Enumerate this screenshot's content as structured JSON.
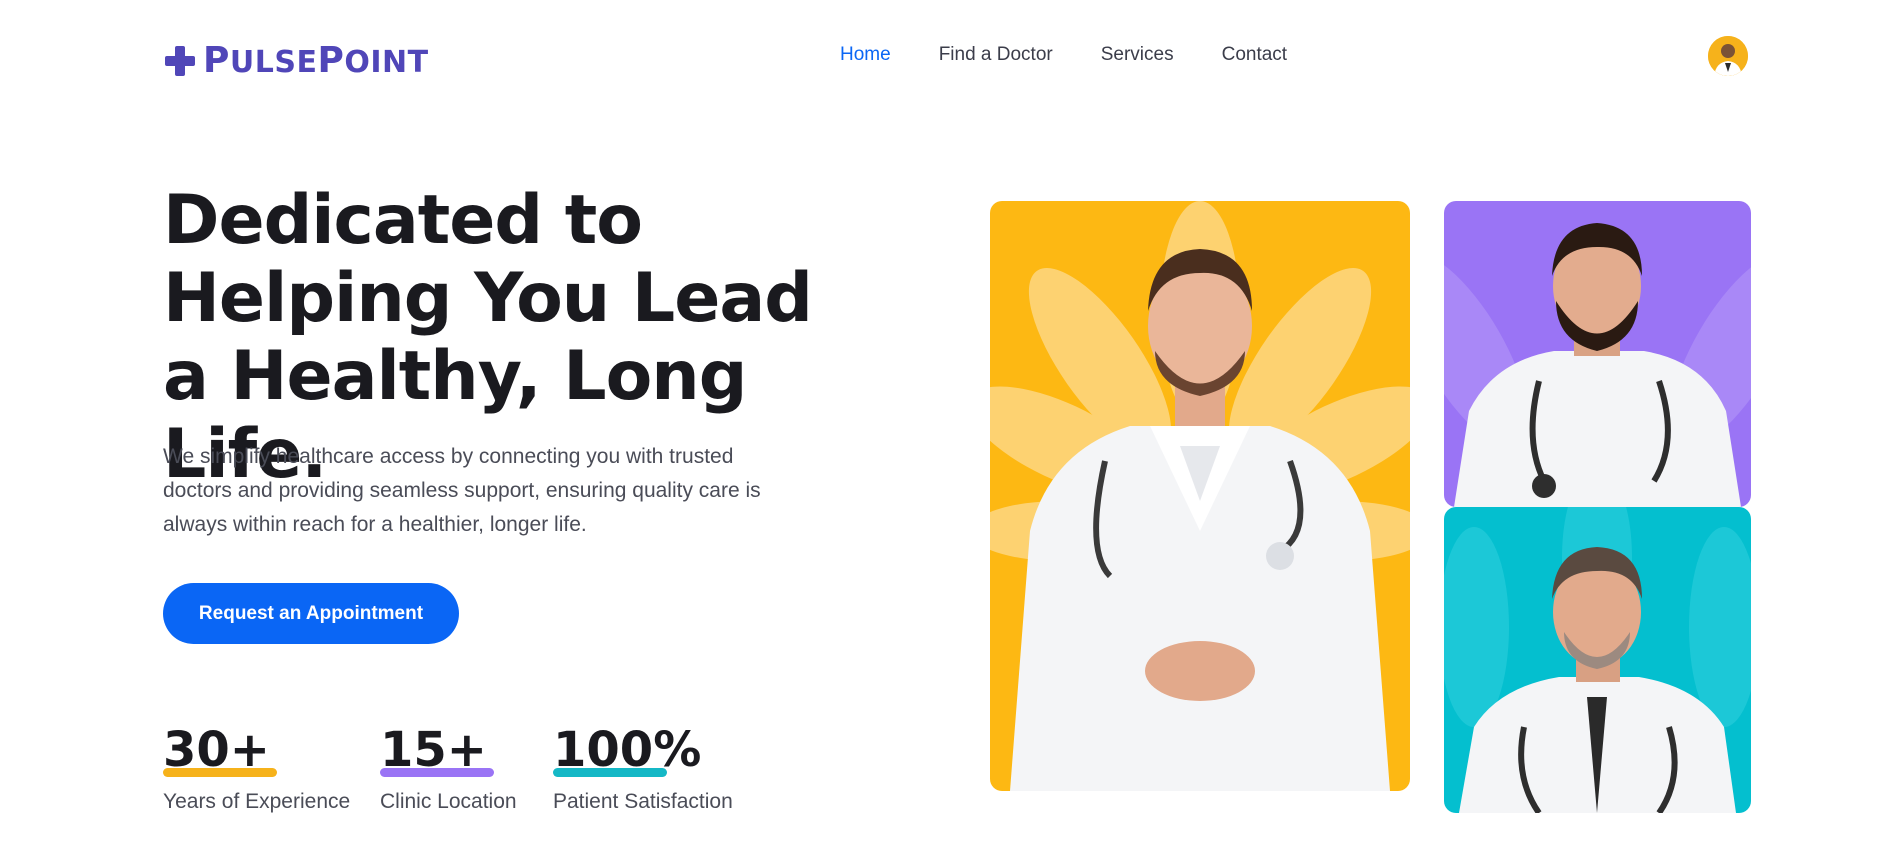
{
  "header": {
    "logo_text": "PulsePoint",
    "nav": [
      {
        "label": "Home",
        "active": true
      },
      {
        "label": "Find a Doctor",
        "active": false
      },
      {
        "label": "Services",
        "active": false
      },
      {
        "label": "Contact",
        "active": false
      }
    ]
  },
  "hero": {
    "title": "Dedicated to Helping You Lead a Healthy, Long Life.",
    "description": "We simplify healthcare access by connecting you with trusted doctors and providing seamless support, ensuring quality care is always within reach for a healthier, longer life.",
    "cta_label": "Request an Appointment"
  },
  "stats": [
    {
      "value": "30+",
      "label": "Years of Experience",
      "color": "#f6b21b"
    },
    {
      "value": "15+",
      "label": "Clinic Location",
      "color": "#9a74f5"
    },
    {
      "value": "100%",
      "label": "Patient Satisfaction",
      "color": "#15b8c6"
    }
  ],
  "colors": {
    "brand": "#5046b8",
    "accent": "#0a66f5",
    "card_yellow": "#fdb813",
    "card_purple": "#9a74f5",
    "card_teal": "#04bfcf"
  },
  "icons": {
    "logo": "medical-cross-icon",
    "avatar": "user-avatar"
  }
}
